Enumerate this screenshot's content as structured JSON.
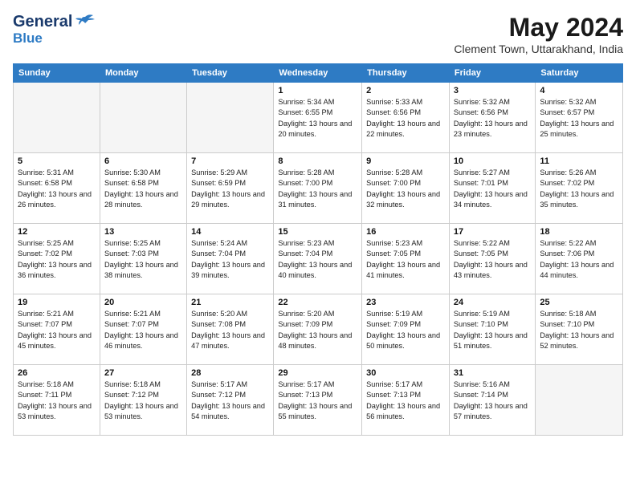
{
  "logo": {
    "line1": "General",
    "line2": "Blue",
    "tagline": ""
  },
  "title": "May 2024",
  "subtitle": "Clement Town, Uttarakhand, India",
  "days_of_week": [
    "Sunday",
    "Monday",
    "Tuesday",
    "Wednesday",
    "Thursday",
    "Friday",
    "Saturday"
  ],
  "weeks": [
    [
      {
        "day": "",
        "empty": true
      },
      {
        "day": "",
        "empty": true
      },
      {
        "day": "",
        "empty": true
      },
      {
        "day": "1",
        "sunrise": "5:34 AM",
        "sunset": "6:55 PM",
        "daylight": "13 hours and 20 minutes."
      },
      {
        "day": "2",
        "sunrise": "5:33 AM",
        "sunset": "6:56 PM",
        "daylight": "13 hours and 22 minutes."
      },
      {
        "day": "3",
        "sunrise": "5:32 AM",
        "sunset": "6:56 PM",
        "daylight": "13 hours and 23 minutes."
      },
      {
        "day": "4",
        "sunrise": "5:32 AM",
        "sunset": "6:57 PM",
        "daylight": "13 hours and 25 minutes."
      }
    ],
    [
      {
        "day": "5",
        "sunrise": "5:31 AM",
        "sunset": "6:58 PM",
        "daylight": "13 hours and 26 minutes."
      },
      {
        "day": "6",
        "sunrise": "5:30 AM",
        "sunset": "6:58 PM",
        "daylight": "13 hours and 28 minutes."
      },
      {
        "day": "7",
        "sunrise": "5:29 AM",
        "sunset": "6:59 PM",
        "daylight": "13 hours and 29 minutes."
      },
      {
        "day": "8",
        "sunrise": "5:28 AM",
        "sunset": "7:00 PM",
        "daylight": "13 hours and 31 minutes."
      },
      {
        "day": "9",
        "sunrise": "5:28 AM",
        "sunset": "7:00 PM",
        "daylight": "13 hours and 32 minutes."
      },
      {
        "day": "10",
        "sunrise": "5:27 AM",
        "sunset": "7:01 PM",
        "daylight": "13 hours and 34 minutes."
      },
      {
        "day": "11",
        "sunrise": "5:26 AM",
        "sunset": "7:02 PM",
        "daylight": "13 hours and 35 minutes."
      }
    ],
    [
      {
        "day": "12",
        "sunrise": "5:25 AM",
        "sunset": "7:02 PM",
        "daylight": "13 hours and 36 minutes."
      },
      {
        "day": "13",
        "sunrise": "5:25 AM",
        "sunset": "7:03 PM",
        "daylight": "13 hours and 38 minutes."
      },
      {
        "day": "14",
        "sunrise": "5:24 AM",
        "sunset": "7:04 PM",
        "daylight": "13 hours and 39 minutes."
      },
      {
        "day": "15",
        "sunrise": "5:23 AM",
        "sunset": "7:04 PM",
        "daylight": "13 hours and 40 minutes."
      },
      {
        "day": "16",
        "sunrise": "5:23 AM",
        "sunset": "7:05 PM",
        "daylight": "13 hours and 41 minutes."
      },
      {
        "day": "17",
        "sunrise": "5:22 AM",
        "sunset": "7:05 PM",
        "daylight": "13 hours and 43 minutes."
      },
      {
        "day": "18",
        "sunrise": "5:22 AM",
        "sunset": "7:06 PM",
        "daylight": "13 hours and 44 minutes."
      }
    ],
    [
      {
        "day": "19",
        "sunrise": "5:21 AM",
        "sunset": "7:07 PM",
        "daylight": "13 hours and 45 minutes."
      },
      {
        "day": "20",
        "sunrise": "5:21 AM",
        "sunset": "7:07 PM",
        "daylight": "13 hours and 46 minutes."
      },
      {
        "day": "21",
        "sunrise": "5:20 AM",
        "sunset": "7:08 PM",
        "daylight": "13 hours and 47 minutes."
      },
      {
        "day": "22",
        "sunrise": "5:20 AM",
        "sunset": "7:09 PM",
        "daylight": "13 hours and 48 minutes."
      },
      {
        "day": "23",
        "sunrise": "5:19 AM",
        "sunset": "7:09 PM",
        "daylight": "13 hours and 50 minutes."
      },
      {
        "day": "24",
        "sunrise": "5:19 AM",
        "sunset": "7:10 PM",
        "daylight": "13 hours and 51 minutes."
      },
      {
        "day": "25",
        "sunrise": "5:18 AM",
        "sunset": "7:10 PM",
        "daylight": "13 hours and 52 minutes."
      }
    ],
    [
      {
        "day": "26",
        "sunrise": "5:18 AM",
        "sunset": "7:11 PM",
        "daylight": "13 hours and 53 minutes."
      },
      {
        "day": "27",
        "sunrise": "5:18 AM",
        "sunset": "7:12 PM",
        "daylight": "13 hours and 53 minutes."
      },
      {
        "day": "28",
        "sunrise": "5:17 AM",
        "sunset": "7:12 PM",
        "daylight": "13 hours and 54 minutes."
      },
      {
        "day": "29",
        "sunrise": "5:17 AM",
        "sunset": "7:13 PM",
        "daylight": "13 hours and 55 minutes."
      },
      {
        "day": "30",
        "sunrise": "5:17 AM",
        "sunset": "7:13 PM",
        "daylight": "13 hours and 56 minutes."
      },
      {
        "day": "31",
        "sunrise": "5:16 AM",
        "sunset": "7:14 PM",
        "daylight": "13 hours and 57 minutes."
      },
      {
        "day": "",
        "empty": true
      }
    ]
  ]
}
